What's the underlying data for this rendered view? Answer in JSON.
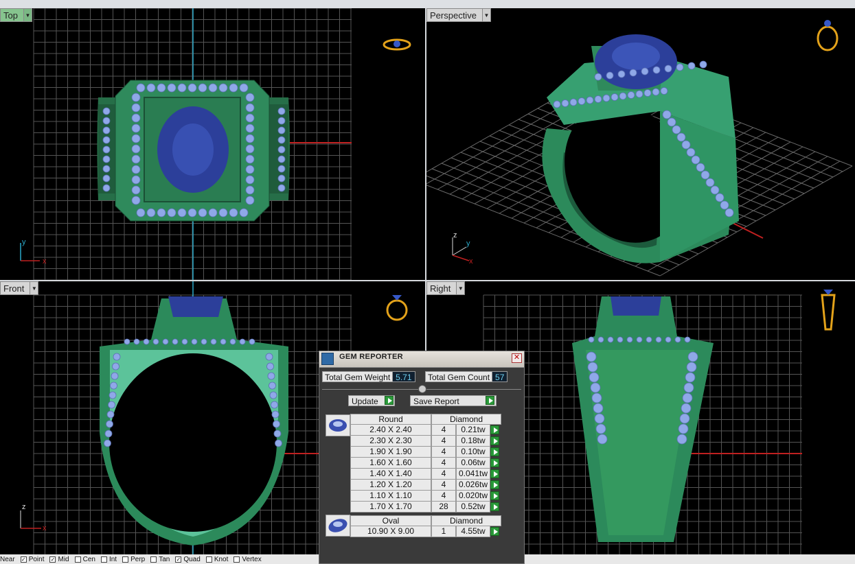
{
  "viewports": {
    "top": {
      "label": "Top",
      "axis_a": "y",
      "axis_b": "x"
    },
    "perspective": {
      "label": "Perspective",
      "axis_a": "z",
      "axis_b": "y",
      "axis_c": "x"
    },
    "front": {
      "label": "Front",
      "axis_a": "z",
      "axis_b": "x"
    },
    "right": {
      "label": "Right"
    }
  },
  "gem_reporter": {
    "title": "GEM REPORTER",
    "total_weight_label": "Total Gem Weight",
    "total_weight_value": "5.71",
    "total_count_label": "Total Gem Count",
    "total_count_value": "57",
    "update_label": "Update",
    "save_report_label": "Save Report",
    "groups": [
      {
        "shape": "Round",
        "material": "Diamond",
        "rows": [
          {
            "size": "2.40 X 2.40",
            "count": "4",
            "weight": "0.21tw"
          },
          {
            "size": "2.30 X 2.30",
            "count": "4",
            "weight": "0.18tw"
          },
          {
            "size": "1.90 X 1.90",
            "count": "4",
            "weight": "0.10tw"
          },
          {
            "size": "1.60 X 1.60",
            "count": "4",
            "weight": "0.06tw"
          },
          {
            "size": "1.40 X 1.40",
            "count": "4",
            "weight": "0.041tw"
          },
          {
            "size": "1.20 X 1.20",
            "count": "4",
            "weight": "0.026tw"
          },
          {
            "size": "1.10 X 1.10",
            "count": "4",
            "weight": "0.020tw"
          },
          {
            "size": "1.70 X 1.70",
            "count": "28",
            "weight": "0.52tw"
          }
        ]
      },
      {
        "shape": "Oval",
        "material": "Diamond",
        "rows": [
          {
            "size": "10.90 X 9.00",
            "count": "1",
            "weight": "4.55tw"
          }
        ]
      }
    ]
  },
  "statusbar": {
    "items": [
      {
        "label": "Near",
        "checked": false
      },
      {
        "label": "Point",
        "checked": true
      },
      {
        "label": "Mid",
        "checked": true
      },
      {
        "label": "Cen",
        "checked": false
      },
      {
        "label": "Int",
        "checked": false
      },
      {
        "label": "Perp",
        "checked": false
      },
      {
        "label": "Tan",
        "checked": false
      },
      {
        "label": "Quad",
        "checked": true
      },
      {
        "label": "Knot",
        "checked": false
      },
      {
        "label": "Vertex",
        "checked": false
      }
    ]
  },
  "colors": {
    "ring_green": "#2e8b57",
    "gem_blue": "#2c3f9a",
    "accent_diamond": "#8fa8e8",
    "grid": "#5a5a5a",
    "axis_red": "#c02020",
    "axis_cyan": "#2aa8c8"
  }
}
